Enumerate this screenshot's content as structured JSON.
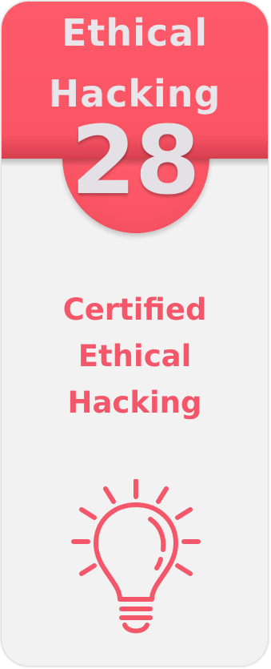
{
  "card": {
    "title_line1": "Ethical",
    "title_line2": "Hacking",
    "number": "28",
    "subtitle_line1": "Certified",
    "subtitle_line2": "Ethical",
    "subtitle_line3": "Hacking"
  },
  "icons": {
    "bulb": "lightbulb-icon"
  },
  "colors": {
    "accent": "#fb5565",
    "card_background": "#f3f2f3",
    "title_text": "#e8e6ea",
    "subtitle_text": "#f4566a"
  }
}
